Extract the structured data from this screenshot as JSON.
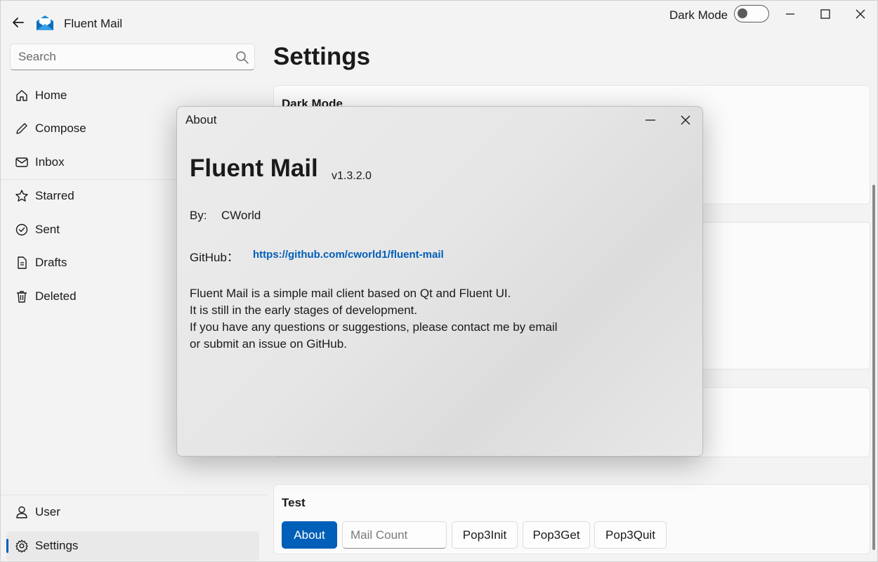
{
  "app": {
    "title": "Fluent Mail",
    "dark_mode_label": "Dark Mode",
    "dark_mode_on": false
  },
  "search": {
    "placeholder": "Search"
  },
  "sidebar": {
    "items": [
      {
        "label": "Home",
        "icon": "home-icon"
      },
      {
        "label": "Compose",
        "icon": "pencil-icon"
      },
      {
        "label": "Inbox",
        "icon": "mail-icon"
      },
      {
        "label": "Starred",
        "icon": "star-icon"
      },
      {
        "label": "Sent",
        "icon": "check-circle-icon"
      },
      {
        "label": "Drafts",
        "icon": "document-icon"
      },
      {
        "label": "Deleted",
        "icon": "trash-icon"
      }
    ],
    "footer": [
      {
        "label": "User",
        "icon": "user-icon"
      },
      {
        "label": "Settings",
        "icon": "gear-icon",
        "active": true
      }
    ]
  },
  "main": {
    "title": "Settings",
    "cards": [
      {
        "title": "Dark Mode"
      },
      {
        "title": "Test"
      }
    ],
    "test": {
      "about_label": "About",
      "mail_count_placeholder": "Mail Count",
      "pop3init_label": "Pop3Init",
      "pop3get_label": "Pop3Get",
      "pop3quit_label": "Pop3Quit"
    }
  },
  "dialog": {
    "title": "About",
    "app_name": "Fluent Mail",
    "version": "v1.3.2.0",
    "by_label": "By:",
    "by_value": "CWorld",
    "github_label": "GitHub：",
    "github_url": "https://github.com/cworld1/fluent-mail",
    "description": [
      "Fluent Mail is a simple mail client based on Qt and Fluent UI.",
      "It is still in the early stages of development.",
      "If you have any questions or suggestions, please contact me by email",
      "or submit an issue on GitHub."
    ]
  },
  "colors": {
    "accent": "#005fb8",
    "background": "#f3f3f3",
    "card": "#fbfbfb"
  }
}
